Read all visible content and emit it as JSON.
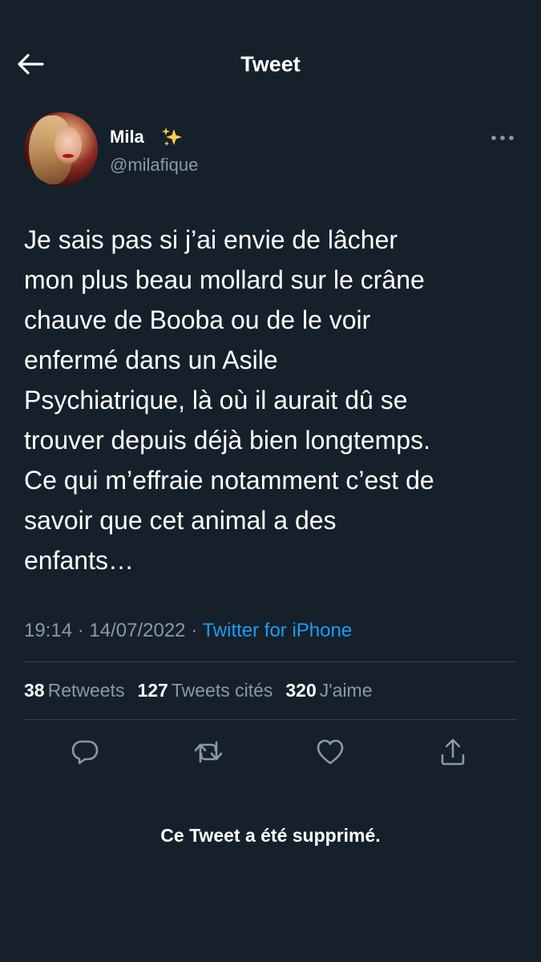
{
  "header": {
    "title": "Tweet",
    "back_icon": "back-arrow-icon"
  },
  "author": {
    "name": "Mila",
    "name_emoji_icon": "sparkles-icon",
    "handle": "@milafique"
  },
  "tweet": {
    "text": "Je sais pas si j’ai envie de lâcher\nmon plus beau mollard sur le crâne\nchauve de Booba ou de le voir\nenfermé dans un Asile\nPsychiatrique, là où il aurait dû se\ntrouver depuis déjà bien longtemps.\nCe qui m’effraie notamment c’est de\nsavoir que cet animal a des\nenfants…",
    "time": "19:14",
    "separator": "·",
    "date": "14/07/2022",
    "source": "Twitter for iPhone"
  },
  "stats": {
    "retweets_count": "38",
    "retweets_label": "Retweets",
    "quotes_count": "127",
    "quotes_label": "Tweets cités",
    "likes_count": "320",
    "likes_label": "J'aime"
  },
  "actions": [
    "reply-icon",
    "retweet-icon",
    "like-icon",
    "share-icon"
  ],
  "notice": {
    "deleted_text": "Ce Tweet a été supprimé."
  },
  "colors": {
    "background": "#15202b",
    "text": "#ffffff",
    "secondary_text": "#8b98a5",
    "accent": "#1d9bf0",
    "divider": "#38444d"
  }
}
